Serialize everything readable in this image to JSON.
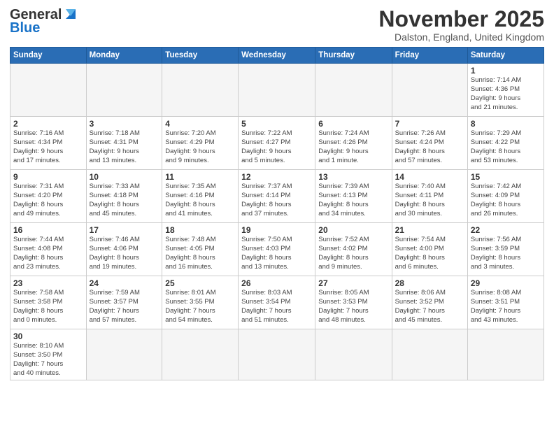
{
  "header": {
    "logo_general": "General",
    "logo_blue": "Blue",
    "month_title": "November 2025",
    "location": "Dalston, England, United Kingdom"
  },
  "weekdays": [
    "Sunday",
    "Monday",
    "Tuesday",
    "Wednesday",
    "Thursday",
    "Friday",
    "Saturday"
  ],
  "weeks": [
    [
      {
        "day": "",
        "info": ""
      },
      {
        "day": "",
        "info": ""
      },
      {
        "day": "",
        "info": ""
      },
      {
        "day": "",
        "info": ""
      },
      {
        "day": "",
        "info": ""
      },
      {
        "day": "",
        "info": ""
      },
      {
        "day": "1",
        "info": "Sunrise: 7:14 AM\nSunset: 4:36 PM\nDaylight: 9 hours\nand 21 minutes."
      }
    ],
    [
      {
        "day": "2",
        "info": "Sunrise: 7:16 AM\nSunset: 4:34 PM\nDaylight: 9 hours\nand 17 minutes."
      },
      {
        "day": "3",
        "info": "Sunrise: 7:18 AM\nSunset: 4:31 PM\nDaylight: 9 hours\nand 13 minutes."
      },
      {
        "day": "4",
        "info": "Sunrise: 7:20 AM\nSunset: 4:29 PM\nDaylight: 9 hours\nand 9 minutes."
      },
      {
        "day": "5",
        "info": "Sunrise: 7:22 AM\nSunset: 4:27 PM\nDaylight: 9 hours\nand 5 minutes."
      },
      {
        "day": "6",
        "info": "Sunrise: 7:24 AM\nSunset: 4:26 PM\nDaylight: 9 hours\nand 1 minute."
      },
      {
        "day": "7",
        "info": "Sunrise: 7:26 AM\nSunset: 4:24 PM\nDaylight: 8 hours\nand 57 minutes."
      },
      {
        "day": "8",
        "info": "Sunrise: 7:29 AM\nSunset: 4:22 PM\nDaylight: 8 hours\nand 53 minutes."
      }
    ],
    [
      {
        "day": "9",
        "info": "Sunrise: 7:31 AM\nSunset: 4:20 PM\nDaylight: 8 hours\nand 49 minutes."
      },
      {
        "day": "10",
        "info": "Sunrise: 7:33 AM\nSunset: 4:18 PM\nDaylight: 8 hours\nand 45 minutes."
      },
      {
        "day": "11",
        "info": "Sunrise: 7:35 AM\nSunset: 4:16 PM\nDaylight: 8 hours\nand 41 minutes."
      },
      {
        "day": "12",
        "info": "Sunrise: 7:37 AM\nSunset: 4:14 PM\nDaylight: 8 hours\nand 37 minutes."
      },
      {
        "day": "13",
        "info": "Sunrise: 7:39 AM\nSunset: 4:13 PM\nDaylight: 8 hours\nand 34 minutes."
      },
      {
        "day": "14",
        "info": "Sunrise: 7:40 AM\nSunset: 4:11 PM\nDaylight: 8 hours\nand 30 minutes."
      },
      {
        "day": "15",
        "info": "Sunrise: 7:42 AM\nSunset: 4:09 PM\nDaylight: 8 hours\nand 26 minutes."
      }
    ],
    [
      {
        "day": "16",
        "info": "Sunrise: 7:44 AM\nSunset: 4:08 PM\nDaylight: 8 hours\nand 23 minutes."
      },
      {
        "day": "17",
        "info": "Sunrise: 7:46 AM\nSunset: 4:06 PM\nDaylight: 8 hours\nand 19 minutes."
      },
      {
        "day": "18",
        "info": "Sunrise: 7:48 AM\nSunset: 4:05 PM\nDaylight: 8 hours\nand 16 minutes."
      },
      {
        "day": "19",
        "info": "Sunrise: 7:50 AM\nSunset: 4:03 PM\nDaylight: 8 hours\nand 13 minutes."
      },
      {
        "day": "20",
        "info": "Sunrise: 7:52 AM\nSunset: 4:02 PM\nDaylight: 8 hours\nand 9 minutes."
      },
      {
        "day": "21",
        "info": "Sunrise: 7:54 AM\nSunset: 4:00 PM\nDaylight: 8 hours\nand 6 minutes."
      },
      {
        "day": "22",
        "info": "Sunrise: 7:56 AM\nSunset: 3:59 PM\nDaylight: 8 hours\nand 3 minutes."
      }
    ],
    [
      {
        "day": "23",
        "info": "Sunrise: 7:58 AM\nSunset: 3:58 PM\nDaylight: 8 hours\nand 0 minutes."
      },
      {
        "day": "24",
        "info": "Sunrise: 7:59 AM\nSunset: 3:57 PM\nDaylight: 7 hours\nand 57 minutes."
      },
      {
        "day": "25",
        "info": "Sunrise: 8:01 AM\nSunset: 3:55 PM\nDaylight: 7 hours\nand 54 minutes."
      },
      {
        "day": "26",
        "info": "Sunrise: 8:03 AM\nSunset: 3:54 PM\nDaylight: 7 hours\nand 51 minutes."
      },
      {
        "day": "27",
        "info": "Sunrise: 8:05 AM\nSunset: 3:53 PM\nDaylight: 7 hours\nand 48 minutes."
      },
      {
        "day": "28",
        "info": "Sunrise: 8:06 AM\nSunset: 3:52 PM\nDaylight: 7 hours\nand 45 minutes."
      },
      {
        "day": "29",
        "info": "Sunrise: 8:08 AM\nSunset: 3:51 PM\nDaylight: 7 hours\nand 43 minutes."
      }
    ],
    [
      {
        "day": "30",
        "info": "Sunrise: 8:10 AM\nSunset: 3:50 PM\nDaylight: 7 hours\nand 40 minutes."
      },
      {
        "day": "",
        "info": ""
      },
      {
        "day": "",
        "info": ""
      },
      {
        "day": "",
        "info": ""
      },
      {
        "day": "",
        "info": ""
      },
      {
        "day": "",
        "info": ""
      },
      {
        "day": "",
        "info": ""
      }
    ]
  ]
}
